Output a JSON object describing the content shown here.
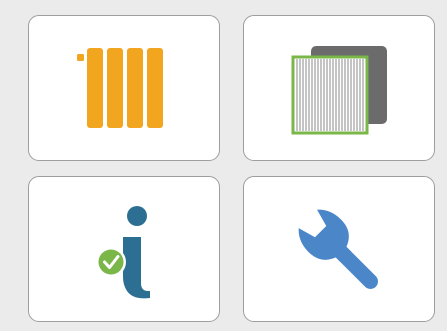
{
  "colors": {
    "background": "#ebebeb",
    "tile_fill": "#ffffff",
    "tile_border": "#9e9e9e",
    "radiator": "#f2a51e",
    "filter_green": "#7ab648",
    "filter_grey": "#6b6b6b",
    "info_blue": "#2d6f93",
    "check_green": "#7ab648",
    "wrench_blue": "#4a86c8"
  },
  "tiles": [
    {
      "icon": "radiator-icon"
    },
    {
      "icon": "air-filter-icon"
    },
    {
      "icon": "info-check-icon"
    },
    {
      "icon": "wrench-icon"
    }
  ]
}
